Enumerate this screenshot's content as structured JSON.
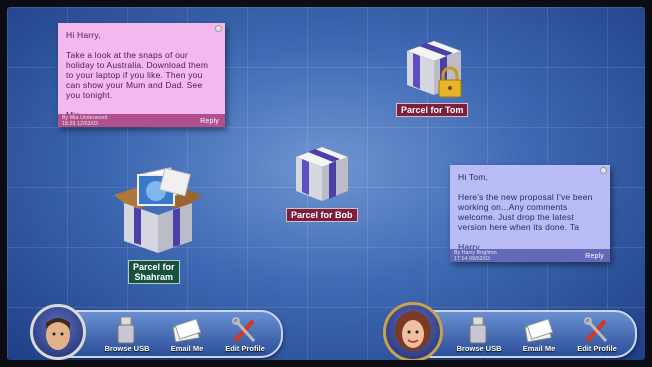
{
  "notes": [
    {
      "body": "Hi Harry,\n\nTake a look at the snaps of our holiday to Australia. Download them to your laptop if you like. Then you can show your Mum and Dad. See you tonight.\n\nMia",
      "footer_author": "By Mia Underwood",
      "footer_time": "18:29  12/03/03",
      "reply_label": "Reply"
    },
    {
      "body": "Hi Tom,\n\nHere's the new proposal I've been working on...Any comments welcome. Just drop the latest version here when its done. Ta\n\nHarry",
      "footer_author": "By Harry Brighton",
      "footer_time": "17:14  09/03/03",
      "reply_label": "Reply"
    }
  ],
  "parcels": {
    "tom": "Parcel for Tom",
    "bob": "Parcel for Bob",
    "shahram_line1": "Parcel for",
    "shahram_line2": "Shahram"
  },
  "docks": [
    {
      "items": {
        "usb": "Browse USB",
        "email": "Email Me",
        "profile": "Edit Profile"
      }
    },
    {
      "items": {
        "usb": "Browse USB",
        "email": "Email Me",
        "profile": "Edit Profile"
      }
    }
  ],
  "icons": {
    "usb": "usb-drive-icon",
    "email": "envelope-icon",
    "profile": "edit-profile-icon",
    "lock": "padlock-icon"
  },
  "colors": {
    "desktop_bg": "#3e69b3",
    "note_pink": "#f3b8ee",
    "note_blue": "#b9bcf5",
    "label_red": "#7b1f3a",
    "label_green": "#16523f",
    "parcel_ribbon": "#4b3fa8"
  }
}
